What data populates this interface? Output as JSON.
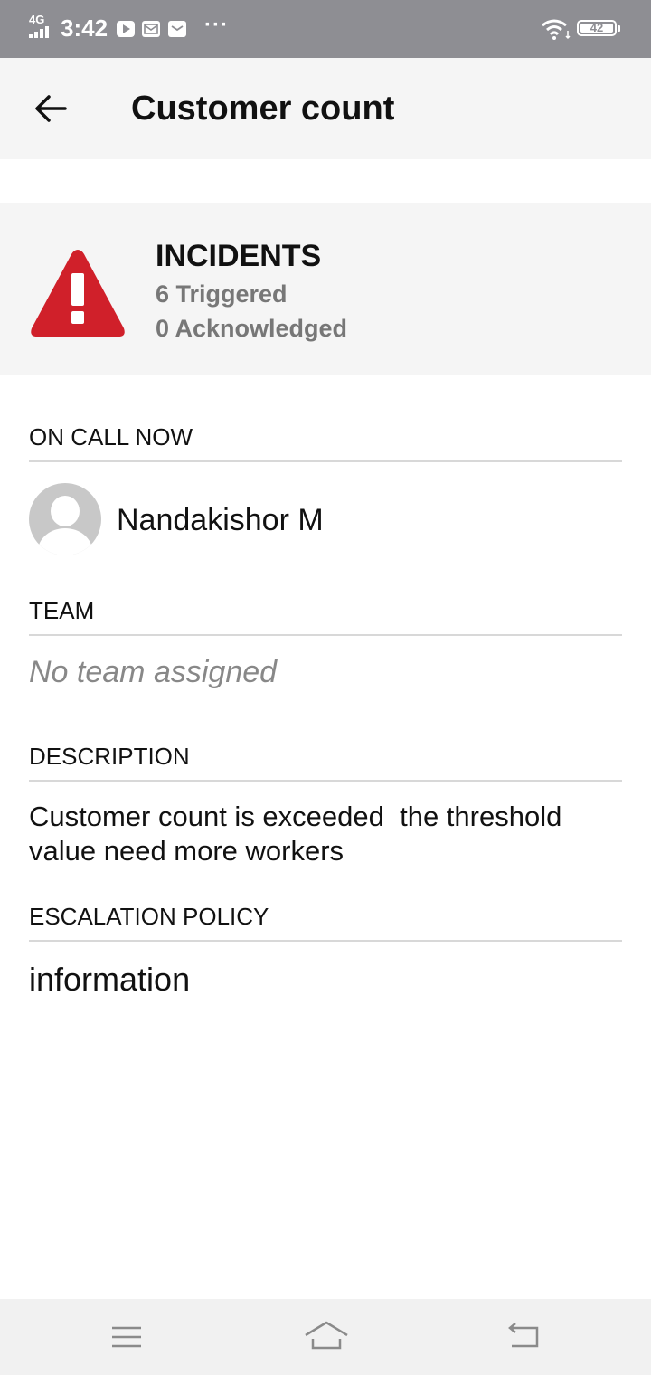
{
  "status_bar": {
    "network": "4G",
    "time": "3:42",
    "notification_icons": [
      "youtube-icon",
      "mail-icon",
      "inbox-icon"
    ],
    "more_dots": "···",
    "battery_level": "42"
  },
  "app_bar": {
    "back_icon": "arrow-left-icon",
    "title": "Customer count"
  },
  "incidents": {
    "icon": "warning-triangle-icon",
    "icon_color": "#d0202a",
    "title": "INCIDENTS",
    "triggered": "6 Triggered",
    "acknowledged": "0 Acknowledged"
  },
  "on_call": {
    "label": "ON CALL NOW",
    "avatar_icon": "user-placeholder-icon",
    "name": "Nandakishor M"
  },
  "team": {
    "label": "TEAM",
    "value": "No team assigned"
  },
  "description": {
    "label": "DESCRIPTION",
    "text": "Customer count is exceeded  the threshold value need more workers"
  },
  "escalation_policy": {
    "label": "ESCALATION POLICY",
    "value": "information"
  },
  "nav_bar": {
    "buttons": [
      "menu-icon",
      "home-icon",
      "back-icon"
    ]
  }
}
